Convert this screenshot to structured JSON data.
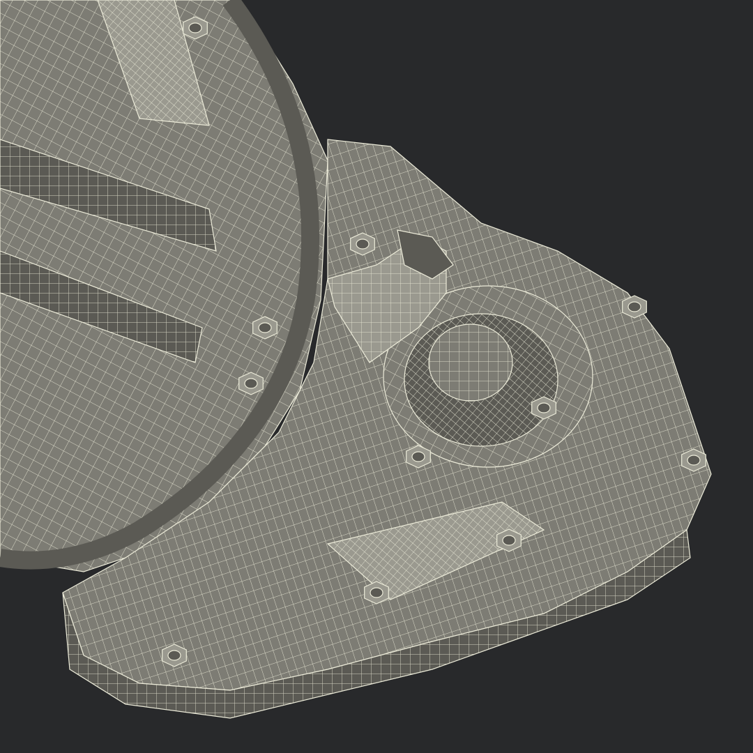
{
  "scene": {
    "background_color": "#28292b",
    "surface_color": "#7d7c74",
    "surface_shadow_color": "#5b5a54",
    "surface_highlight_color": "#9a998f",
    "wire_color": "#ecebd9",
    "content": "wireframe-3d-render"
  }
}
